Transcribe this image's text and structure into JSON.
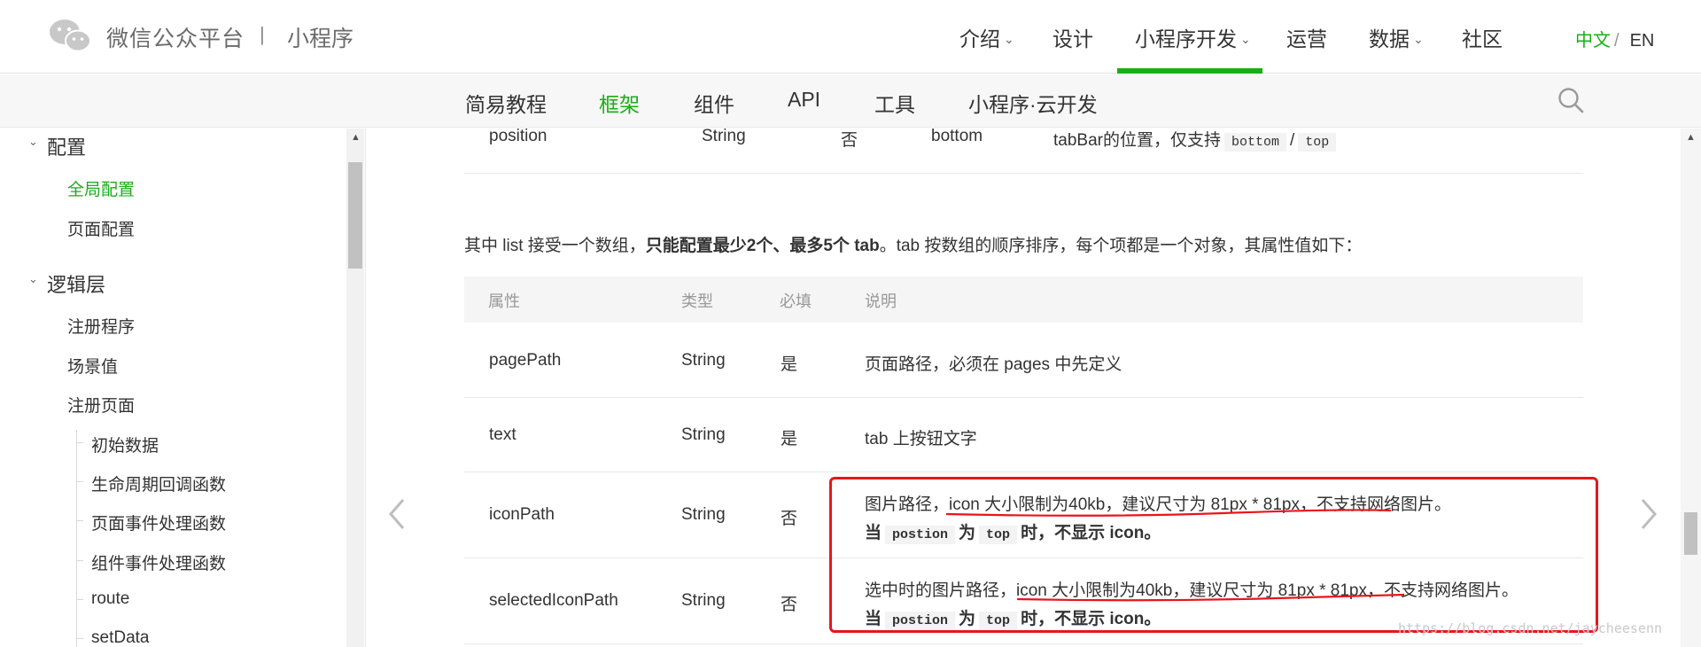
{
  "header": {
    "brand": "微信公众平台",
    "separator": "|",
    "sub": "小程序",
    "nav": [
      {
        "label": "介绍",
        "dropdown": true
      },
      {
        "label": "设计",
        "dropdown": false
      },
      {
        "label": "小程序开发",
        "dropdown": true,
        "active": true
      },
      {
        "label": "运营",
        "dropdown": false
      },
      {
        "label": "数据",
        "dropdown": true
      },
      {
        "label": "社区",
        "dropdown": false
      }
    ],
    "chevron": "⌄",
    "lang_zh": "中文",
    "lang_slash": "/",
    "lang_en": "EN"
  },
  "subnav": {
    "items": [
      "简易教程",
      "框架",
      "组件",
      "API",
      "工具",
      "小程序·云开发"
    ],
    "active_index": 1
  },
  "sidebar": {
    "caret": "⌄",
    "group1": "配置",
    "group1_items": [
      "全局配置",
      "页面配置"
    ],
    "group2": "逻辑层",
    "group2_items": [
      "注册程序",
      "场景值",
      "注册页面"
    ],
    "sub_items": [
      "初始数据",
      "生命周期回调函数",
      "页面事件处理函数",
      "组件事件处理函数",
      "route",
      "setData"
    ]
  },
  "content": {
    "top_row": {
      "name": "position",
      "type": "String",
      "required": "否",
      "default": "bottom",
      "desc_prefix": "tabBar的位置，仅支持",
      "code1": "bottom",
      "slash": "/",
      "code2": "top"
    },
    "para_prefix": "其中 list 接受一个数组，",
    "para_bold": "只能配置最少2个、最多5个 tab",
    "para_suffix": "。tab 按数组的顺序排序，每个项都是一个对象，其属性值如下：",
    "table": {
      "headers": [
        "属性",
        "类型",
        "必填",
        "说明"
      ],
      "rows": [
        {
          "name": "pagePath",
          "type": "String",
          "required": "是",
          "desc": "页面路径，必须在 pages 中先定义"
        },
        {
          "name": "text",
          "type": "String",
          "required": "是",
          "desc": "tab 上按钮文字"
        },
        {
          "name": "iconPath",
          "type": "String",
          "required": "否",
          "desc_line1": "图片路径，icon 大小限制为40kb，建议尺寸为 81px * 81px，不支持网络图片。",
          "w1": "当",
          "code1": "postion",
          "w2": "为",
          "code2": "top",
          "w3": "时，不显示 icon。"
        },
        {
          "name": "selectedIconPath",
          "type": "String",
          "required": "否",
          "desc_line1": "选中时的图片路径，icon 大小限制为40kb，建议尺寸为 81px * 81px，不支持网络图片。",
          "w1": "当",
          "code1": "postion",
          "w2": "为",
          "code2": "top",
          "w3": "时，不显示 icon。"
        }
      ]
    }
  },
  "watermark": "https://blog.csdn.net/jaycheesenn",
  "colors": {
    "accent": "#1aad19",
    "annotation": "#e8151b"
  }
}
